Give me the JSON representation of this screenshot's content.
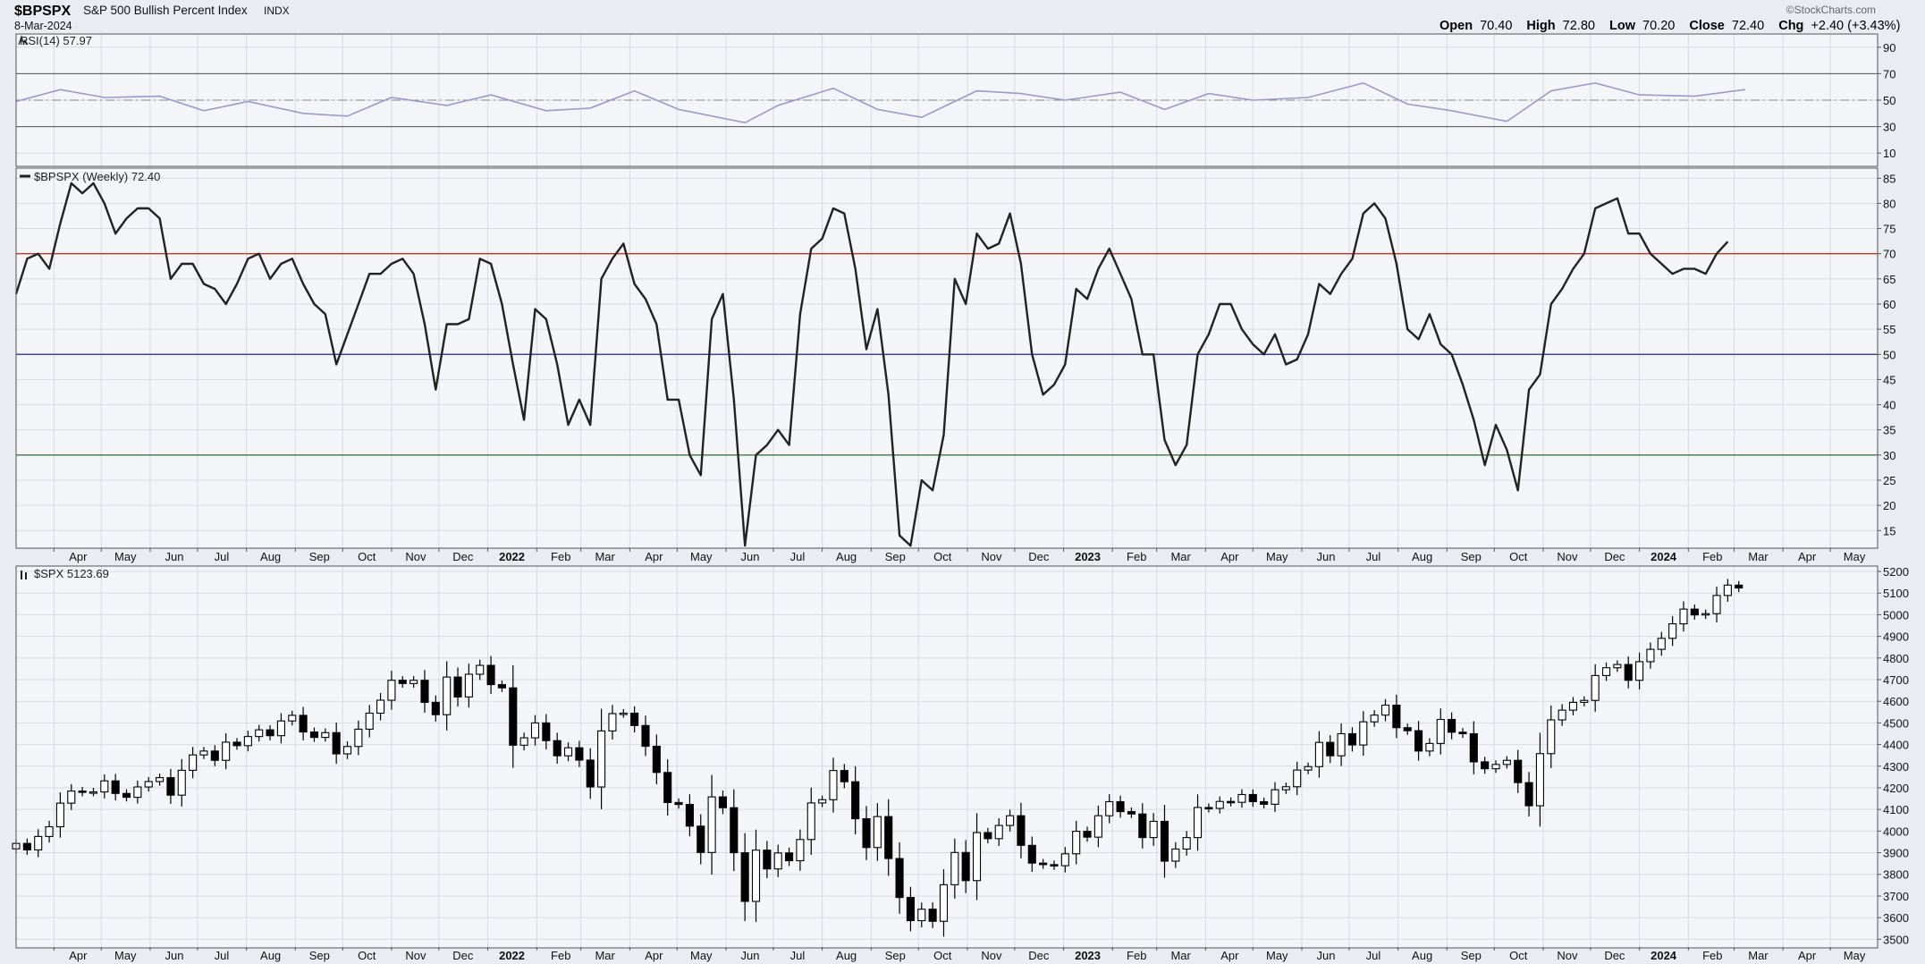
{
  "header": {
    "symbol": "$BPSPX",
    "name": "S&P 500 Bullish Percent Index",
    "exchange": "INDX",
    "date": "8-Mar-2024",
    "watermark": "©StockCharts.com",
    "ohlc": [
      {
        "label": "Open",
        "value": "70.40"
      },
      {
        "label": "High",
        "value": "72.80"
      },
      {
        "label": "Low",
        "value": "70.20"
      },
      {
        "label": "Close",
        "value": "72.40"
      },
      {
        "label": "Chg",
        "value": "+2.40 (+3.43%)"
      }
    ]
  },
  "colors": {
    "background": "#ffffff",
    "panel_bg": "#f4f5f9",
    "grid": "#d7dae2",
    "rsi_line": "#9a9acb",
    "bpi_line": "#222222",
    "line70": "#c0392b",
    "line50": "#1f2d80",
    "line30": "#2e6b2e",
    "candle": "#000000"
  },
  "x_axis": {
    "labels": [
      "Apr",
      "May",
      "Jun",
      "Jul",
      "Aug",
      "Sep",
      "Oct",
      "Nov",
      "Dec",
      "2022",
      "Feb",
      "Mar",
      "Apr",
      "May",
      "Jun",
      "Jul",
      "Aug",
      "Sep",
      "Oct",
      "Nov",
      "Dec",
      "2023",
      "Feb",
      "Mar",
      "Apr",
      "May",
      "Jun",
      "Jul",
      "Aug",
      "Sep",
      "Oct",
      "Nov",
      "Dec",
      "2024",
      "Feb",
      "Mar",
      "Apr",
      "May"
    ],
    "start": "2021-03-08",
    "end": "2024-05-31"
  },
  "chart_data": [
    {
      "type": "line",
      "label": "RSI(14) 57.97",
      "ylim": [
        0,
        100
      ],
      "yticks": [
        10,
        30,
        50,
        70,
        90
      ],
      "reference_lines": [
        30,
        50,
        70
      ],
      "x": [
        "2021-03-08",
        "2021-04-05",
        "2021-05-03",
        "2021-06-07",
        "2021-07-05",
        "2021-08-02",
        "2021-09-06",
        "2021-10-04",
        "2021-11-01",
        "2021-12-06",
        "2022-01-03",
        "2022-02-07",
        "2022-03-07",
        "2022-04-04",
        "2022-05-02",
        "2022-06-13",
        "2022-07-04",
        "2022-08-08",
        "2022-09-05",
        "2022-10-03",
        "2022-11-07",
        "2022-12-05",
        "2023-01-02",
        "2023-02-06",
        "2023-03-06",
        "2023-04-03",
        "2023-05-01",
        "2023-06-05",
        "2023-07-10",
        "2023-08-07",
        "2023-09-04",
        "2023-10-09",
        "2023-11-06",
        "2023-12-04",
        "2024-01-01",
        "2024-02-05",
        "2024-03-08"
      ],
      "values": [
        49,
        58,
        52,
        53,
        42,
        49,
        40,
        38,
        52,
        46,
        54,
        42,
        44,
        57,
        43,
        33,
        46,
        59,
        43,
        37,
        57,
        55,
        50,
        56,
        43,
        55,
        50,
        52,
        63,
        47,
        42,
        34,
        57,
        63,
        54,
        53,
        57.97
      ]
    },
    {
      "type": "line",
      "label": "$BPSPX (Weekly) 72.40",
      "ylim": [
        11.5,
        87
      ],
      "yticks": [
        15,
        20,
        25,
        30,
        35,
        40,
        45,
        50,
        55,
        60,
        65,
        70,
        75,
        80,
        85
      ],
      "reference_lines": [
        30,
        50,
        70
      ],
      "x": [
        "2021-03-08",
        "2021-03-15",
        "2021-03-22",
        "2021-03-29",
        "2021-04-05",
        "2021-04-12",
        "2021-04-19",
        "2021-04-26",
        "2021-05-03",
        "2021-05-10",
        "2021-05-17",
        "2021-05-24",
        "2021-05-31",
        "2021-06-07",
        "2021-06-14",
        "2021-06-21",
        "2021-06-28",
        "2021-07-05",
        "2021-07-12",
        "2021-07-19",
        "2021-07-26",
        "2021-08-02",
        "2021-08-09",
        "2021-08-16",
        "2021-08-23",
        "2021-08-30",
        "2021-09-06",
        "2021-09-13",
        "2021-09-20",
        "2021-09-27",
        "2021-10-04",
        "2021-10-11",
        "2021-10-18",
        "2021-10-25",
        "2021-11-01",
        "2021-11-08",
        "2021-11-15",
        "2021-11-22",
        "2021-11-29",
        "2021-12-06",
        "2021-12-13",
        "2021-12-20",
        "2021-12-27",
        "2022-01-03",
        "2022-01-10",
        "2022-01-17",
        "2022-01-24",
        "2022-01-31",
        "2022-02-07",
        "2022-02-14",
        "2022-02-21",
        "2022-02-28",
        "2022-03-07",
        "2022-03-14",
        "2022-03-21",
        "2022-03-28",
        "2022-04-04",
        "2022-04-11",
        "2022-04-18",
        "2022-04-25",
        "2022-05-02",
        "2022-05-09",
        "2022-05-16",
        "2022-05-23",
        "2022-05-30",
        "2022-06-06",
        "2022-06-13",
        "2022-06-20",
        "2022-06-27",
        "2022-07-04",
        "2022-07-11",
        "2022-07-18",
        "2022-07-25",
        "2022-08-01",
        "2022-08-08",
        "2022-08-15",
        "2022-08-22",
        "2022-08-29",
        "2022-09-05",
        "2022-09-12",
        "2022-09-19",
        "2022-09-26",
        "2022-10-03",
        "2022-10-10",
        "2022-10-17",
        "2022-10-24",
        "2022-10-31",
        "2022-11-07",
        "2022-11-14",
        "2022-11-21",
        "2022-11-28",
        "2022-12-05",
        "2022-12-12",
        "2022-12-19",
        "2022-12-26",
        "2023-01-02",
        "2023-01-09",
        "2023-01-16",
        "2023-01-23",
        "2023-01-30",
        "2023-02-06",
        "2023-02-13",
        "2023-02-20",
        "2023-02-27",
        "2023-03-06",
        "2023-03-13",
        "2023-03-20",
        "2023-03-27",
        "2023-04-03",
        "2023-04-10",
        "2023-04-17",
        "2023-04-24",
        "2023-05-01",
        "2023-05-08",
        "2023-05-15",
        "2023-05-22",
        "2023-05-29",
        "2023-06-05",
        "2023-06-12",
        "2023-06-19",
        "2023-06-26",
        "2023-07-03",
        "2023-07-10",
        "2023-07-17",
        "2023-07-24",
        "2023-07-31",
        "2023-08-07",
        "2023-08-14",
        "2023-08-21",
        "2023-08-28",
        "2023-09-04",
        "2023-09-11",
        "2023-09-18",
        "2023-09-25",
        "2023-10-02",
        "2023-10-09",
        "2023-10-16",
        "2023-10-23",
        "2023-10-30",
        "2023-11-06",
        "2023-11-13",
        "2023-11-20",
        "2023-11-27",
        "2023-12-04",
        "2023-12-11",
        "2023-12-18",
        "2023-12-25",
        "2024-01-01",
        "2024-01-08",
        "2024-01-15",
        "2024-01-22",
        "2024-01-29",
        "2024-02-05",
        "2024-02-12",
        "2024-02-19",
        "2024-02-26",
        "2024-03-04"
      ],
      "values": [
        62,
        69,
        70,
        67,
        76,
        84,
        82,
        84,
        80,
        74,
        77,
        79,
        79,
        77,
        65,
        68,
        68,
        64,
        63,
        60,
        64,
        69,
        70,
        65,
        68,
        69,
        64,
        60,
        58,
        48,
        54,
        60,
        66,
        66,
        68,
        69,
        66,
        56,
        43,
        56,
        56,
        57,
        69,
        68,
        60,
        48,
        37,
        59,
        57,
        48,
        36,
        41,
        36,
        65,
        69,
        72,
        64,
        61,
        56,
        41,
        41,
        30,
        26,
        57,
        62,
        41,
        12,
        30,
        32,
        35,
        32,
        58,
        71,
        73,
        79,
        78,
        67,
        51,
        59,
        42,
        14,
        12,
        25,
        23,
        34,
        65,
        60,
        74,
        71,
        72,
        78,
        68,
        50,
        42,
        44,
        48,
        63,
        61,
        67,
        71,
        66,
        61,
        50,
        50,
        33,
        28,
        32,
        50,
        54,
        60,
        60,
        55,
        52,
        50,
        54,
        48,
        49,
        54,
        64,
        62,
        66,
        69,
        78,
        80,
        77,
        68,
        55,
        53,
        58,
        52,
        50,
        44,
        37,
        28,
        36,
        31,
        23,
        43,
        46,
        60,
        63,
        67,
        70,
        79,
        80,
        81,
        74,
        74,
        70,
        68,
        66,
        67,
        67,
        66,
        70,
        72.4
      ]
    },
    {
      "type": "candlestick",
      "label": "$SPX 5123.69",
      "ylim": [
        3460,
        5225
      ],
      "yticks": [
        3500,
        3600,
        3700,
        3800,
        3900,
        4000,
        4100,
        4200,
        4300,
        4400,
        4500,
        4600,
        4700,
        4800,
        4900,
        5000,
        5100,
        5200
      ],
      "x": [
        "2021-03-08",
        "2021-03-15",
        "2021-03-22",
        "2021-03-29",
        "2021-04-05",
        "2021-04-12",
        "2021-04-19",
        "2021-04-26",
        "2021-05-03",
        "2021-05-10",
        "2021-05-17",
        "2021-05-24",
        "2021-05-31",
        "2021-06-07",
        "2021-06-14",
        "2021-06-21",
        "2021-06-28",
        "2021-07-05",
        "2021-07-12",
        "2021-07-19",
        "2021-07-26",
        "2021-08-02",
        "2021-08-09",
        "2021-08-16",
        "2021-08-23",
        "2021-08-30",
        "2021-09-06",
        "2021-09-13",
        "2021-09-20",
        "2021-09-27",
        "2021-10-04",
        "2021-10-11",
        "2021-10-18",
        "2021-10-25",
        "2021-11-01",
        "2021-11-08",
        "2021-11-15",
        "2021-11-22",
        "2021-11-29",
        "2021-12-06",
        "2021-12-13",
        "2021-12-20",
        "2021-12-27",
        "2022-01-03",
        "2022-01-10",
        "2022-01-17",
        "2022-01-24",
        "2022-01-31",
        "2022-02-07",
        "2022-02-14",
        "2022-02-21",
        "2022-02-28",
        "2022-03-07",
        "2022-03-14",
        "2022-03-21",
        "2022-03-28",
        "2022-04-04",
        "2022-04-11",
        "2022-04-18",
        "2022-04-25",
        "2022-05-02",
        "2022-05-09",
        "2022-05-16",
        "2022-05-23",
        "2022-05-30",
        "2022-06-06",
        "2022-06-13",
        "2022-06-20",
        "2022-06-27",
        "2022-07-04",
        "2022-07-11",
        "2022-07-18",
        "2022-07-25",
        "2022-08-01",
        "2022-08-08",
        "2022-08-15",
        "2022-08-22",
        "2022-08-29",
        "2022-09-05",
        "2022-09-12",
        "2022-09-19",
        "2022-09-26",
        "2022-10-03",
        "2022-10-10",
        "2022-10-17",
        "2022-10-24",
        "2022-10-31",
        "2022-11-07",
        "2022-11-14",
        "2022-11-21",
        "2022-11-28",
        "2022-12-05",
        "2022-12-12",
        "2022-12-19",
        "2022-12-26",
        "2023-01-02",
        "2023-01-09",
        "2023-01-16",
        "2023-01-23",
        "2023-01-30",
        "2023-02-06",
        "2023-02-13",
        "2023-02-20",
        "2023-02-27",
        "2023-03-06",
        "2023-03-13",
        "2023-03-20",
        "2023-03-27",
        "2023-04-03",
        "2023-04-10",
        "2023-04-17",
        "2023-04-24",
        "2023-05-01",
        "2023-05-08",
        "2023-05-15",
        "2023-05-22",
        "2023-05-29",
        "2023-06-05",
        "2023-06-12",
        "2023-06-19",
        "2023-06-26",
        "2023-07-03",
        "2023-07-10",
        "2023-07-17",
        "2023-07-24",
        "2023-07-31",
        "2023-08-07",
        "2023-08-14",
        "2023-08-21",
        "2023-08-28",
        "2023-09-04",
        "2023-09-11",
        "2023-09-18",
        "2023-09-25",
        "2023-10-02",
        "2023-10-09",
        "2023-10-16",
        "2023-10-23",
        "2023-10-30",
        "2023-11-06",
        "2023-11-13",
        "2023-11-20",
        "2023-11-27",
        "2023-12-04",
        "2023-12-11",
        "2023-12-18",
        "2023-12-25",
        "2024-01-01",
        "2024-01-08",
        "2024-01-15",
        "2024-01-22",
        "2024-01-29",
        "2024-02-05",
        "2024-02-12",
        "2024-02-19",
        "2024-02-26",
        "2024-03-04"
      ],
      "close": [
        3943,
        3913,
        3975,
        4020,
        4129,
        4185,
        4180,
        4181,
        4232,
        4174,
        4156,
        4204,
        4229,
        4247,
        4166,
        4281,
        4352,
        4370,
        4327,
        4411,
        4395,
        4437,
        4468,
        4441,
        4509,
        4535,
        4458,
        4433,
        4455,
        4357,
        4391,
        4471,
        4545,
        4605,
        4697,
        4682,
        4697,
        4595,
        4538,
        4712,
        4620,
        4725,
        4766,
        4677,
        4662,
        4397,
        4431,
        4500,
        4418,
        4348,
        4385,
        4328,
        4204,
        4463,
        4543,
        4545,
        4488,
        4392,
        4271,
        4132,
        4123,
        4023,
        3901,
        4158,
        4108,
        3900,
        3675,
        3912,
        3825,
        3899,
        3863,
        3961,
        4130,
        4145,
        4280,
        4228,
        4057,
        3924,
        4067,
        3873,
        3693,
        3586,
        3639,
        3583,
        3752,
        3901,
        3771,
        3993,
        3965,
        4026,
        4071,
        3934,
        3852,
        3845,
        3840,
        3895,
        3999,
        3972,
        4071,
        4136,
        4090,
        4079,
        3970,
        4045,
        3861,
        3917,
        3970,
        4109,
        4105,
        4137,
        4133,
        4169,
        4136,
        4124,
        4191,
        4205,
        4282,
        4298,
        4410,
        4348,
        4450,
        4398,
        4505,
        4536,
        4582,
        4478,
        4464,
        4370,
        4405,
        4516,
        4457,
        4450,
        4320,
        4288,
        4308,
        4327,
        4224,
        4117,
        4358,
        4514,
        4559,
        4595,
        4604,
        4719,
        4755,
        4770,
        4697,
        4783,
        4840,
        4891,
        4958,
        5026,
        4999,
        5005,
        5089,
        5137,
        5123.69
      ]
    }
  ]
}
